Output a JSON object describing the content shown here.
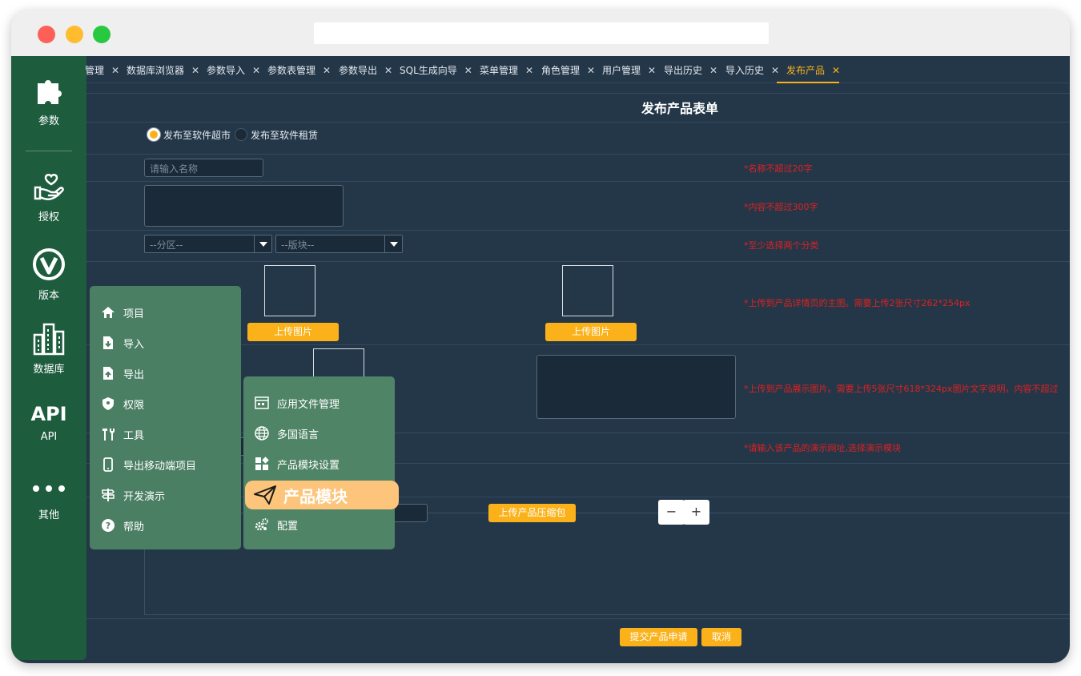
{
  "sidebar": {
    "items": [
      {
        "label": "参数",
        "icon": "puzzle-icon"
      },
      {
        "label": "授权",
        "icon": "hand-heart-icon"
      },
      {
        "label": "版本",
        "icon": "version-v-icon"
      },
      {
        "label": "数据库",
        "icon": "buildings-icon"
      },
      {
        "label": "API",
        "icon": "api-icon"
      },
      {
        "label": "其他",
        "icon": "more-dots-icon"
      }
    ]
  },
  "tabs": [
    {
      "label": "管理"
    },
    {
      "label": "数据库浏览器"
    },
    {
      "label": "参数导入"
    },
    {
      "label": "参数表管理"
    },
    {
      "label": "参数导出"
    },
    {
      "label": "SQL生成向导"
    },
    {
      "label": "菜单管理"
    },
    {
      "label": "角色管理"
    },
    {
      "label": "用户管理"
    },
    {
      "label": "导出历史"
    },
    {
      "label": "导入历史"
    },
    {
      "label": "发布产品",
      "active": true
    }
  ],
  "tab_close_glyph": "✕",
  "form": {
    "title": "发布产品表单",
    "radio_market": "发布至软件超市",
    "radio_rent": "发布至软件租赁",
    "name_placeholder": "请输入名称",
    "name_hint": "*名称不超过20字",
    "content_hint": "*内容不超过300字",
    "section_select": "--分区--",
    "block_select": "--版块--",
    "category_hint": "*至少选择两个分类",
    "upload_image": "上传图片",
    "main_image_hint": "*上传到产品详情页的主图。需要上传2张尺寸262*254px",
    "display_image_hint": "*上传到产品展示图片。需要上传5张尺寸618*324px图片文字说明，内容不超过",
    "demo_hint": "*请输入该产品的演示网址,选择演示模块",
    "upload_package": "上传产品压缩包",
    "minus": "−",
    "plus": "+",
    "submit": "提交产品申请",
    "cancel": "取消"
  },
  "menu_main": [
    {
      "label": "项目",
      "icon": "home-icon"
    },
    {
      "label": "导入",
      "icon": "import-file-icon"
    },
    {
      "label": "导出",
      "icon": "export-file-icon"
    },
    {
      "label": "权限",
      "icon": "shield-icon"
    },
    {
      "label": "工具",
      "icon": "tools-icon"
    },
    {
      "label": "导出移动端项目",
      "icon": "mobile-icon"
    },
    {
      "label": "开发演示",
      "icon": "signpost-icon"
    },
    {
      "label": "帮助",
      "icon": "help-icon"
    }
  ],
  "menu_sub": [
    {
      "label": "应用文件管理",
      "icon": "app-file-icon"
    },
    {
      "label": "多国语言",
      "icon": "globe-icon"
    },
    {
      "label": "产品模块设置",
      "icon": "modules-icon"
    },
    {
      "label": "产品模块",
      "icon": "paper-plane-icon",
      "highlighted": true
    },
    {
      "label": "配置",
      "icon": "gears-icon"
    }
  ],
  "colors": {
    "accent": "#fbb21a",
    "sidebar": "#1e5c3e",
    "background": "#243749",
    "hint": "#e02020",
    "menu": "#4b7f64",
    "highlight": "#fdc57b"
  }
}
